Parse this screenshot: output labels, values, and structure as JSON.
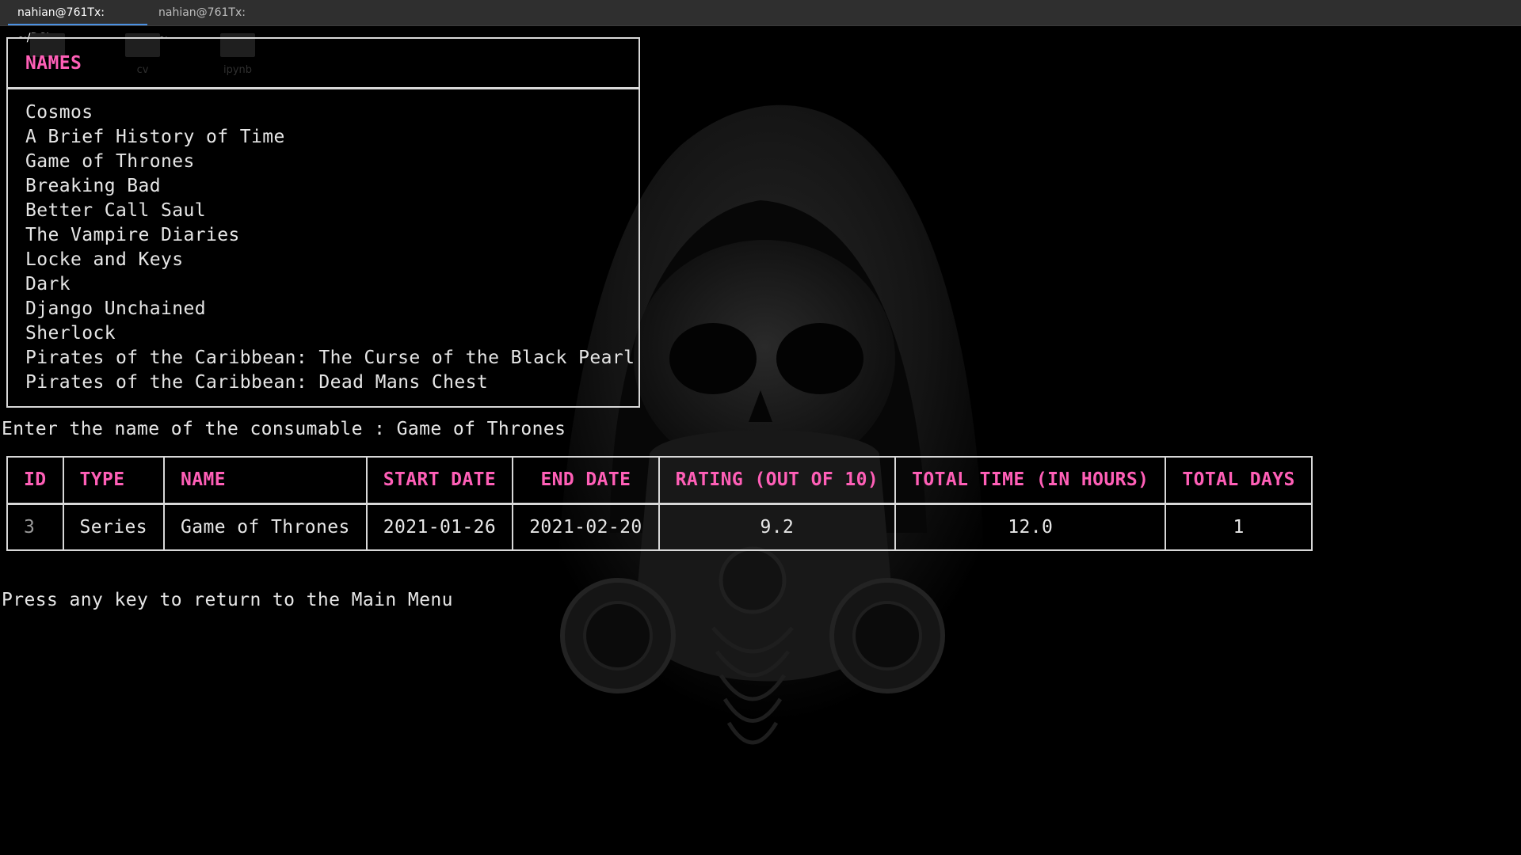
{
  "tabs": [
    {
      "label": "nahian@761Tx: ~/DSI",
      "active": true
    },
    {
      "label": "nahian@761Tx: ~",
      "active": false
    }
  ],
  "desktop_icons": [
    {
      "label": ""
    },
    {
      "label": "cv"
    },
    {
      "label": "ipynb"
    }
  ],
  "names_panel": {
    "title": "NAMES",
    "items": [
      "Cosmos",
      "A Brief History of Time",
      "Game of Thrones",
      "Breaking Bad",
      "Better Call Saul",
      "The Vampire Diaries",
      "Locke and Keys",
      "Dark",
      "Django Unchained",
      "Sherlock",
      "Pirates of the Caribbean: The Curse of the Black Pearl",
      "Pirates of the Caribbean: Dead Mans Chest"
    ]
  },
  "prompt_line": "Enter the name of the consumable : Game of Thrones",
  "result_table": {
    "columns": [
      "ID",
      "TYPE",
      "NAME",
      "START DATE",
      "END DATE",
      "RATING (OUT OF 10)",
      "TOTAL TIME (IN HOURS)",
      "TOTAL DAYS"
    ],
    "rows": [
      [
        "3",
        "Series",
        "Game of Thrones",
        "2021-01-26",
        "2021-02-20",
        "9.2",
        "12.0",
        "1"
      ]
    ]
  },
  "footer_message": "Press any key to return to the Main Menu",
  "colors": {
    "background": "#000000",
    "accent_pink": "#ff5fb7",
    "text": "#e6e6e6",
    "border": "#d8d8d8",
    "tab_underline": "#4a90e2"
  },
  "icons": [
    "hooded-skull-gasmask-wallpaper"
  ]
}
